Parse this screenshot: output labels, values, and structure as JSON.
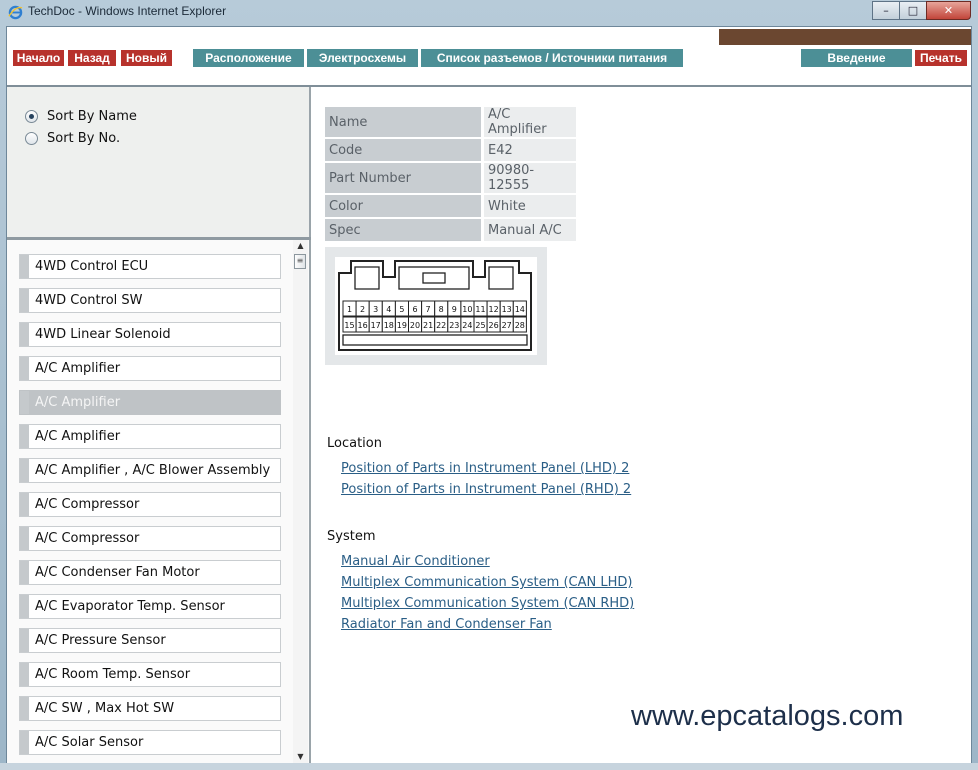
{
  "window": {
    "title": "TechDoc - Windows Internet Explorer",
    "min": "–",
    "max": "□",
    "close": "✕"
  },
  "nav": {
    "home": "Начало",
    "back": "Назад",
    "new": "Новый",
    "location": "Расположение",
    "wiring": "Электросхемы",
    "connectors": "Список разъемов / Источники питания",
    "intro": "Введение",
    "print": "Печать"
  },
  "sort": {
    "by_name": "Sort By Name",
    "by_no": "Sort By No."
  },
  "list": [
    "4WD Control ECU",
    "4WD Control SW",
    "4WD Linear Solenoid",
    "A/C Amplifier",
    "A/C Amplifier",
    "A/C Amplifier",
    "A/C Amplifier , A/C Blower Assembly",
    "A/C Compressor",
    "A/C Compressor",
    "A/C Condenser Fan Motor",
    "A/C Evaporator Temp. Sensor",
    "A/C Pressure Sensor",
    "A/C Room Temp. Sensor",
    "A/C SW , Max Hot SW",
    "A/C Solar Sensor"
  ],
  "selected_index": 4,
  "details": [
    {
      "key": "Name",
      "value": "A/C Amplifier"
    },
    {
      "key": "Code",
      "value": "E42"
    },
    {
      "key": "Part Number",
      "value": "90980-12555"
    },
    {
      "key": "Color",
      "value": "White"
    },
    {
      "key": "Spec",
      "value": "Manual A/C"
    }
  ],
  "connector_pins_top": [
    "1",
    "2",
    "3",
    "4",
    "5",
    "6",
    "7",
    "8",
    "9",
    "10",
    "11",
    "12",
    "13",
    "14"
  ],
  "connector_pins_bottom": [
    "15",
    "16",
    "17",
    "18",
    "19",
    "20",
    "21",
    "22",
    "23",
    "24",
    "25",
    "26",
    "27",
    "28"
  ],
  "location": {
    "title": "Location",
    "links": [
      "Position of Parts in Instrument Panel (LHD) 2",
      "Position of Parts in Instrument Panel (RHD) 2"
    ]
  },
  "system": {
    "title": "System",
    "links": [
      "Manual Air Conditioner",
      "Multiplex Communication System (CAN LHD)",
      "Multiplex Communication System (CAN RHD)",
      "Radiator Fan and Condenser Fan"
    ]
  },
  "watermark": "www.epcatalogs.com",
  "colors": {
    "nav_red": "#b7322c",
    "nav_teal": "#4c8f96",
    "link": "#2a5e86",
    "brown_bar": "#6b4730"
  }
}
